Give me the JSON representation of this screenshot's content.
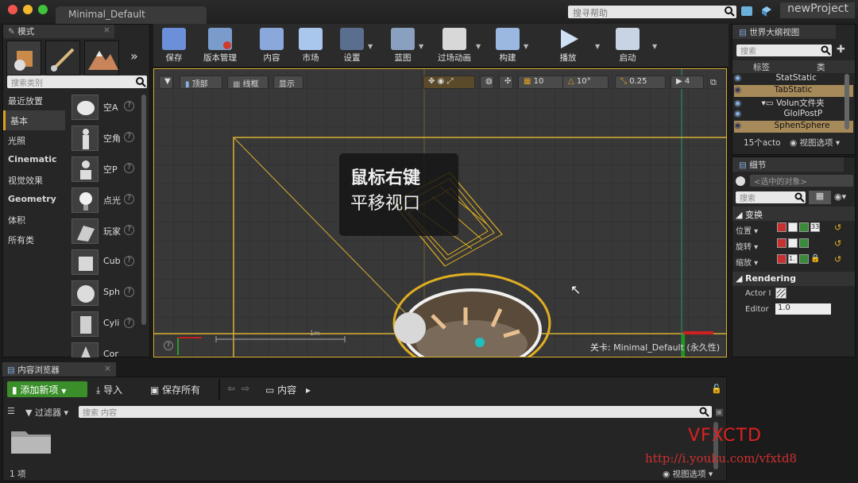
{
  "window": {
    "tab_title": "Minimal_Default",
    "help_search_placeholder": "搜寻帮助",
    "project_name": "newProject"
  },
  "modes_panel": {
    "tab_label": "模式",
    "search_placeholder": "搜索类别",
    "categories": [
      "最近放置",
      "基本",
      "光照",
      "Cinematic",
      "视觉效果",
      "Geometry",
      "体积",
      "所有类"
    ],
    "items": [
      "空A",
      "空角",
      "空P",
      "点光",
      "玩家",
      "Cub",
      "Sph",
      "Cyli",
      "Cor"
    ],
    "help_glyph": "?"
  },
  "toolbar": {
    "buttons": [
      "保存",
      "版本管理",
      "内容",
      "市场",
      "设置",
      "蓝图",
      "过场动画",
      "构建",
      "播放",
      "启动"
    ]
  },
  "viewport": {
    "view_label": "顶部",
    "wireframe_label": "线框",
    "show_label": "显示",
    "grid_snap": "10",
    "rot_snap": "10°",
    "scale_snap": "0.25",
    "cam_speed": "4",
    "overlay_line1": "鼠标右键",
    "overlay_line2": "平移视口",
    "scale_label": "1m",
    "level_prefix": "关卡:",
    "level_name": "Minimal_Default (永久性)"
  },
  "outliner": {
    "tab_label": "世界大纲视图",
    "search_placeholder": "搜索",
    "col_label": "标签",
    "col_type": "类",
    "rows": [
      "StatStatic",
      "TabStatic",
      "Volun文件夹",
      "GlolPostP",
      "SphenSphere"
    ],
    "count_label": "15个acto",
    "view_options": "视图选项"
  },
  "details": {
    "tab_label": "细节",
    "selected_label": "<选中的对象>",
    "search_placeholder": "搜索",
    "transform_label": "变换",
    "location_label": "位置",
    "rotation_label": "旋转",
    "scale_label": "缩放",
    "loc_value": "33",
    "scale_value": "1.",
    "rendering_label": "Rendering",
    "actor_hidden_label": "Actor I",
    "editor_label": "Editor",
    "editor_value": "1.0"
  },
  "content_browser": {
    "tab_label": "内容浏览器",
    "add_new": "添加新项",
    "import": "导入",
    "save_all": "保存所有",
    "path": "内容",
    "filters": "过滤器",
    "search_placeholder": "搜索 内容",
    "item_count": "1 项",
    "view_options": "视图选项"
  },
  "watermark": {
    "brand": "VFXCTD",
    "url": "http://i.youku.com/vfxtd8"
  },
  "colors": {
    "accent": "#e0a020",
    "wire": "#d8b030",
    "add_green": "#3a8f2a"
  }
}
